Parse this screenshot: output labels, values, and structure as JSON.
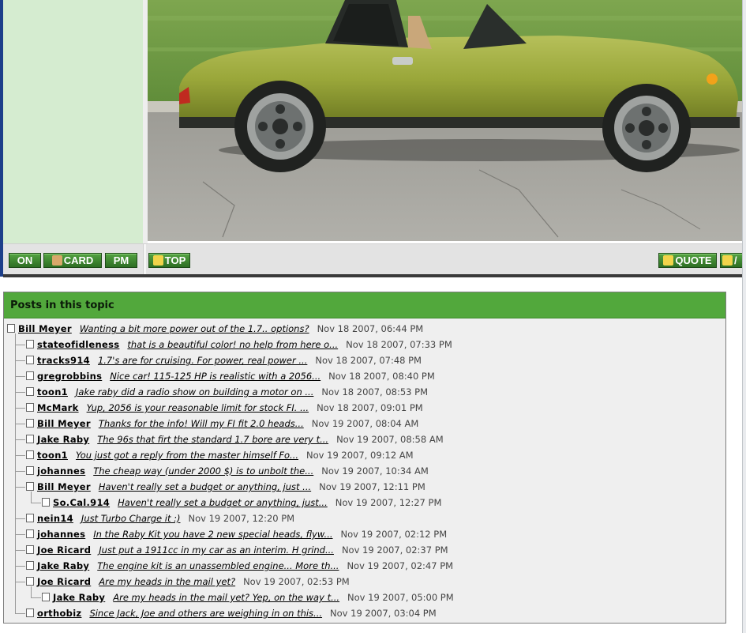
{
  "toolbar": {
    "online": "ON",
    "card": "CARD",
    "pm": "PM",
    "top": "TOP",
    "quote": "QUOTE",
    "reply_partial": "/"
  },
  "colors": {
    "header_green": "#52a83c",
    "button_green": "#3f8a30",
    "side_green": "#d5ecd0"
  },
  "posts_section": {
    "title": "Posts in this topic",
    "items": [
      {
        "author": "Bill Meyer",
        "subject": "Wanting a bit more power out of the 1.7.. options?",
        "date": "Nov 18 2007, 06:44 PM",
        "depth": 0
      },
      {
        "author": "stateofidleness",
        "subject": "that is a beautiful color! no help from here o...",
        "date": "Nov 18 2007, 07:33 PM",
        "depth": 1
      },
      {
        "author": "tracks914",
        "subject": "1.7's are for cruising. For power, real power ...",
        "date": "Nov 18 2007, 07:48 PM",
        "depth": 1
      },
      {
        "author": "gregrobbins",
        "subject": "Nice car! 115-125 HP is realistic with a 2056...",
        "date": "Nov 18 2007, 08:40 PM",
        "depth": 1
      },
      {
        "author": "toon1",
        "subject": "Jake raby did a radio show on building a motor on ...",
        "date": "Nov 18 2007, 08:53 PM",
        "depth": 1
      },
      {
        "author": "McMark",
        "subject": "Yup, 2056 is your reasonable limit for stock FI. ...",
        "date": "Nov 18 2007, 09:01 PM",
        "depth": 1
      },
      {
        "author": "Bill Meyer",
        "subject": "Thanks for the info! Will my FI fit 2.0 heads...",
        "date": "Nov 19 2007, 08:04 AM",
        "depth": 1
      },
      {
        "author": "Jake Raby",
        "subject": "The 96s that firt the standard 1.7 bore are very t...",
        "date": "Nov 19 2007, 08:58 AM",
        "depth": 1
      },
      {
        "author": "toon1",
        "subject": "You just got a reply from the master himself Fo...",
        "date": "Nov 19 2007, 09:12 AM",
        "depth": 1
      },
      {
        "author": "johannes",
        "subject": "The cheap way (under 2000 $) is to unbolt the...",
        "date": "Nov 19 2007, 10:34 AM",
        "depth": 1
      },
      {
        "author": "Bill Meyer",
        "subject": "Haven't really set a budget or anything, just ...",
        "date": "Nov 19 2007, 12:11 PM",
        "depth": 1
      },
      {
        "author": "So.Cal.914",
        "subject": "Haven't really set a budget or anything, just...",
        "date": "Nov 19 2007, 12:27 PM",
        "depth": 2
      },
      {
        "author": "nein14",
        "subject": "Just Turbo Charge it :)",
        "date": "Nov 19 2007, 12:20 PM",
        "depth": 1
      },
      {
        "author": "johannes",
        "subject": "In the Raby Kit you have 2 new special heads, flyw...",
        "date": "Nov 19 2007, 02:12 PM",
        "depth": 1
      },
      {
        "author": "Joe Ricard",
        "subject": "Just put a 1911cc in my car as an interim. H grind...",
        "date": "Nov 19 2007, 02:37 PM",
        "depth": 1
      },
      {
        "author": "Jake Raby",
        "subject": "The engine kit is an unassembled engine... More th...",
        "date": "Nov 19 2007, 02:47 PM",
        "depth": 1
      },
      {
        "author": "Joe Ricard",
        "subject": "Are my heads in the mail yet?",
        "date": "Nov 19 2007, 02:53 PM",
        "depth": 1
      },
      {
        "author": "Jake Raby",
        "subject": "Are my heads in the mail yet? Yep, on the way t...",
        "date": "Nov 19 2007, 05:00 PM",
        "depth": 2
      },
      {
        "author": "orthobiz",
        "subject": "Since Jack, Joe and others are weighing in on this...",
        "date": "Nov 19 2007, 03:04 PM",
        "depth": 1
      }
    ]
  }
}
